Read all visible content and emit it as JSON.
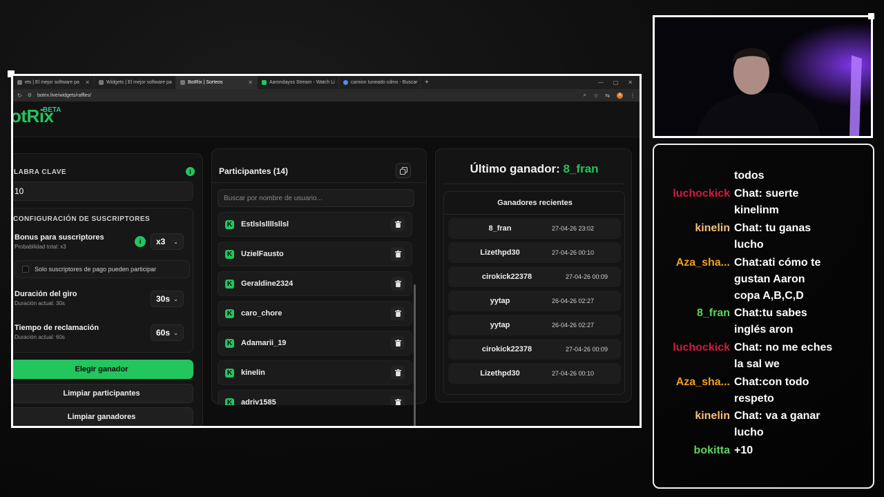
{
  "browser": {
    "tabs": [
      {
        "label": "ets | El mejor software pa",
        "icon": "bot-icon",
        "active": false
      },
      {
        "label": "Widgets | El mejor software pa",
        "icon": "bot-icon",
        "active": false
      },
      {
        "label": "BotRix | Sorteos",
        "icon": "bot-icon",
        "active": true
      },
      {
        "label": "Aarondayss Stream - Watch Li",
        "icon": "kick-icon",
        "active": false
      },
      {
        "label": "camion tuneado cdmx - Buscar",
        "icon": "google-icon",
        "active": false
      }
    ],
    "new_tab": "+",
    "url": "botrix.live/widgets/raffles/",
    "profile_initial": "A"
  },
  "site": {
    "logo": "otRix",
    "beta": "BETA"
  },
  "config": {
    "keyword_label": "LABRA CLAVE",
    "keyword_value": "10",
    "subs_section_label": "CONFIGURACIÓN DE SUSCRIPTORES",
    "bonus_title": "Bonus para suscriptores",
    "bonus_sub": "Probabilidad total: x3",
    "bonus_value": "x3",
    "paid_only_label": "Solo suscriptores de pago pueden participar",
    "spin_title": "Duración del giro",
    "spin_sub": "Duración actual: 30s",
    "spin_value": "30s",
    "claim_title": "Tiempo de reclamación",
    "claim_sub": "Duración actual: 60s",
    "claim_value": "60s",
    "pick_winner": "Elegir ganador",
    "clear_participants": "Limpiar participantes",
    "clear_winners": "Limpiar ganadores"
  },
  "participants": {
    "title": "Participantes (14)",
    "search_placeholder": "Buscar por nombre de usuario...",
    "items": [
      "Estlslsllllsllsl",
      "UzielFausto",
      "Geraldine2324",
      "caro_chore",
      "Adamarii_19",
      "kinelin",
      "adriv1585",
      "Ar...y..k..."
    ]
  },
  "winners": {
    "last_label": "Último ganador:",
    "last_name": "8_fran",
    "recent_title": "Ganadores recientes",
    "items": [
      {
        "name": "8_fran",
        "date": "27-04-26 23:02"
      },
      {
        "name": "Lizethpd30",
        "date": "27-04-26 00:10"
      },
      {
        "name": "cirokick22378",
        "date": "27-04-26 00:09"
      },
      {
        "name": "yytap",
        "date": "26-04-26 02:27"
      },
      {
        "name": "yytap",
        "date": "26-04-26 02:27"
      },
      {
        "name": "cirokick22378",
        "date": "27-04-26 00:09"
      },
      {
        "name": "Lizethpd30",
        "date": "27-04-26 00:10"
      }
    ]
  },
  "chat": {
    "messages": [
      {
        "user": "",
        "color": "#ffffff",
        "lines": [
          "todos"
        ]
      },
      {
        "user": "luchockick",
        "color": "#d21b3c",
        "lines": [
          "Chat: suerte",
          "kinelinm"
        ]
      },
      {
        "user": "kinelin",
        "color": "#f5c17a",
        "lines": [
          "Chat: tu ganas",
          "lucho"
        ]
      },
      {
        "user": "Aza_sha...",
        "color": "#f0a020",
        "lines": [
          "Chat:ati cómo te",
          "gustan Aaron",
          "copa A,B,C,D"
        ]
      },
      {
        "user": "8_fran",
        "color": "#5ad45a",
        "lines": [
          "Chat:tu sabes",
          "inglés aron"
        ]
      },
      {
        "user": "luchockick",
        "color": "#d21b3c",
        "lines": [
          "Chat: no me eches",
          "la sal we"
        ]
      },
      {
        "user": "Aza_sha...",
        "color": "#f0a020",
        "lines": [
          "Chat:con todo",
          "respeto"
        ]
      },
      {
        "user": "kinelin",
        "color": "#f5c17a",
        "lines": [
          "Chat: va a ganar",
          "lucho"
        ]
      },
      {
        "user": "bokitta",
        "color": "#5ad45a",
        "lines": [
          "+10"
        ]
      }
    ]
  },
  "colors": {
    "accent": "#22c55e",
    "frame": "#ffffff"
  }
}
